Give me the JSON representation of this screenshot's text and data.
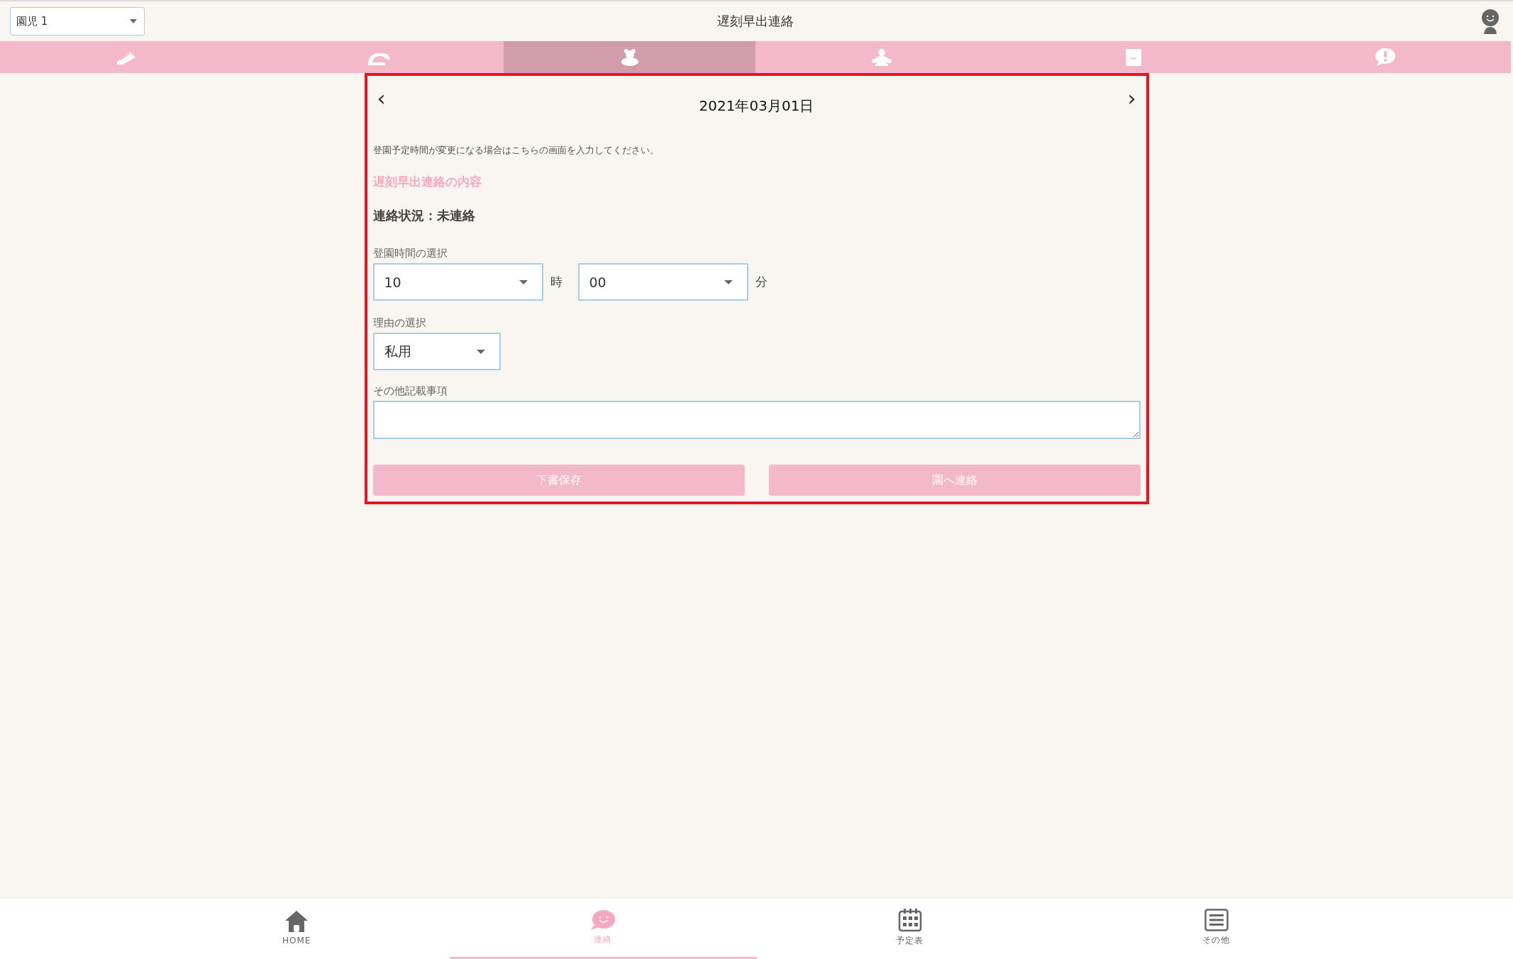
{
  "header": {
    "child_select": {
      "value": "園児 1"
    },
    "title": "遅刻早出連絡"
  },
  "tabs": [
    {
      "selected": false
    },
    {
      "selected": false
    },
    {
      "selected": true
    },
    {
      "selected": false
    },
    {
      "selected": false
    },
    {
      "selected": false
    }
  ],
  "date_nav": {
    "prev": "‹",
    "date": "2021年03月01日",
    "next": "›"
  },
  "description": "登園予定時間が変更になる場合はこちらの画面を入力してください。",
  "section_title": "遅刻早出連絡の内容",
  "status": "連絡状況：未連絡",
  "arrival_time": {
    "label": "登園時間の選択",
    "hour": "10",
    "hour_unit": "時",
    "minute": "00",
    "minute_unit": "分"
  },
  "reason": {
    "label": "理由の選択",
    "value": "私用"
  },
  "notes": {
    "label": "その他記載事項"
  },
  "buttons": [
    {
      "label": "下書保存",
      "disabled": true
    },
    {
      "label": "園へ連絡",
      "disabled": true
    }
  ],
  "bottom_nav": [
    {
      "label": "HOME",
      "selected": false
    },
    {
      "label": "連絡",
      "selected": true
    },
    {
      "label": "予定表",
      "selected": false
    },
    {
      "label": "その他",
      "selected": false
    }
  ]
}
